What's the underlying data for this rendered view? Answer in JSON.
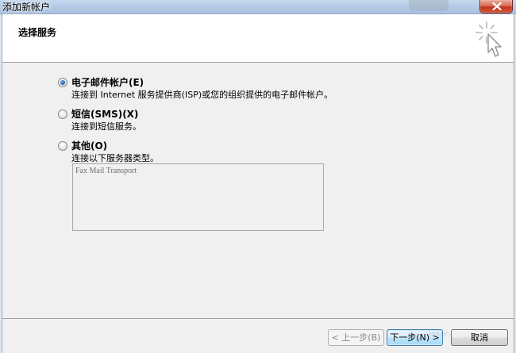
{
  "window": {
    "title": "添加新帐户"
  },
  "header": {
    "heading": "选择服务",
    "icon": "wizard-cursor-icon"
  },
  "options": [
    {
      "label": "电子邮件帐户(E)",
      "description": "连接到 Internet 服务提供商(ISP)或您的组织提供的电子邮件帐户。",
      "checked": true
    },
    {
      "label": "短信(SMS)(X)",
      "description": "连接到短信服务。",
      "checked": false
    },
    {
      "label": "其他(O)",
      "description": "连接以下服务器类型。",
      "checked": false
    }
  ],
  "server_types": [
    "Fax Mail Transport"
  ],
  "footer": {
    "back_label": "< 上一步(B)",
    "next_label": "下一步(N) >",
    "cancel_label": "取消",
    "watermark": "Joker.com"
  },
  "colors": {
    "accent": "#1f5fa8",
    "close_button": "#c2321b"
  }
}
